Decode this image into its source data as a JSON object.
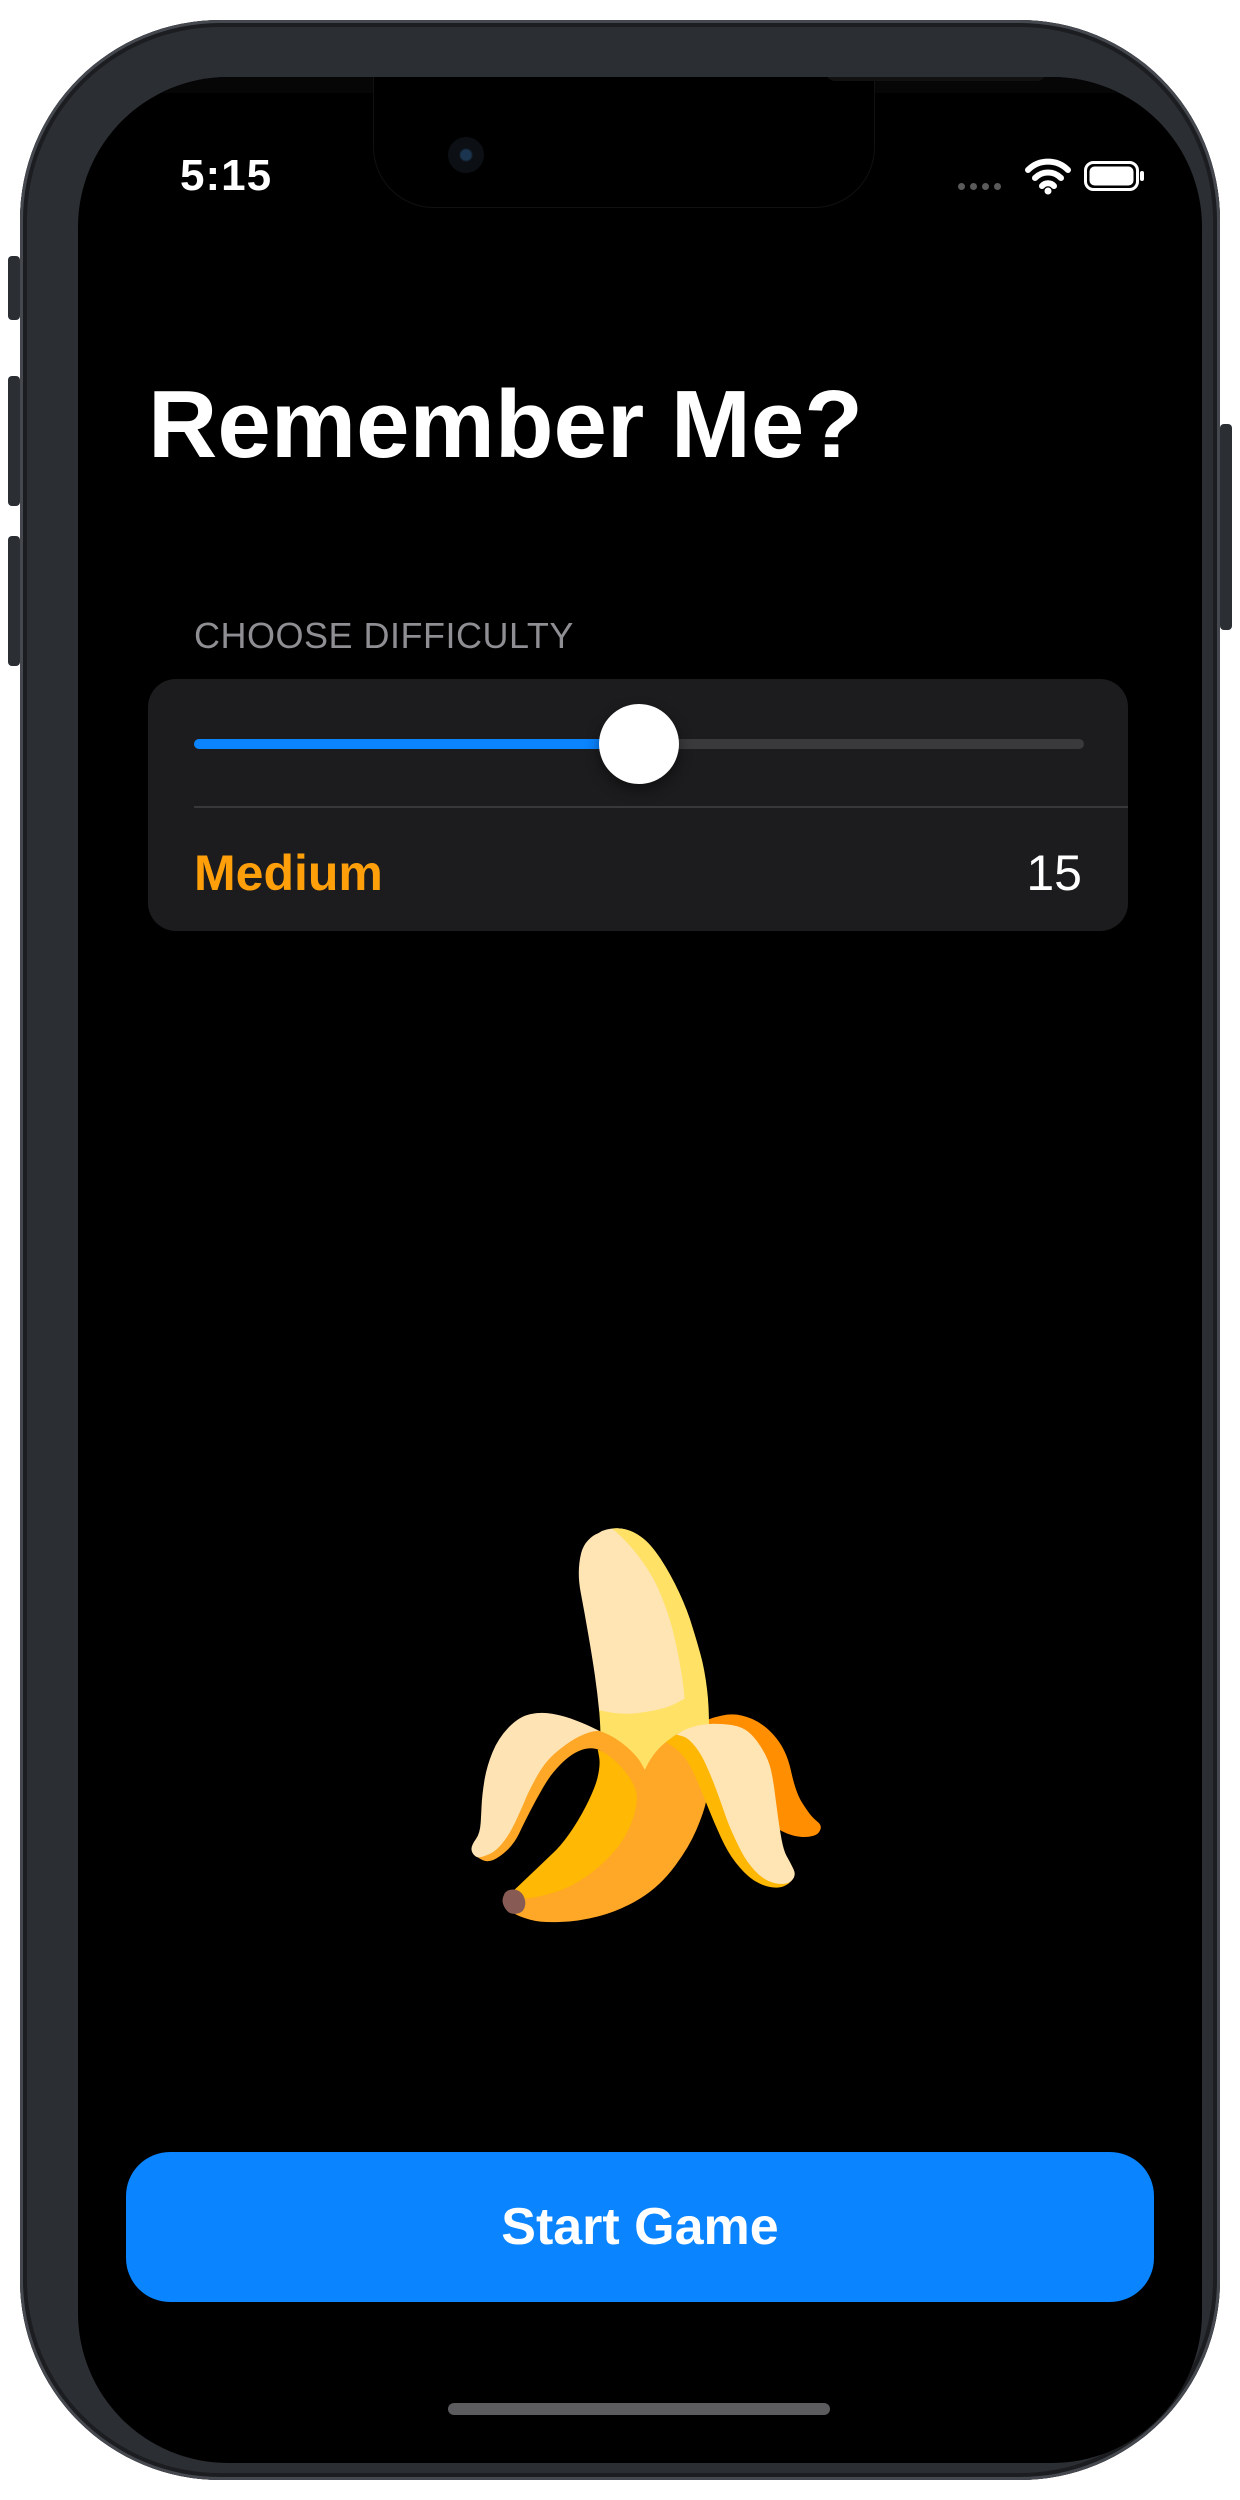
{
  "status_bar": {
    "time": "5:15",
    "icons": [
      "signal-dots-icon",
      "wifi-icon",
      "battery-icon"
    ]
  },
  "header": {
    "title": "Remember Me?"
  },
  "difficulty": {
    "section_label": "CHOOSE DIFFICULTY",
    "slider_fraction": 0.5,
    "level_name": "Medium",
    "value": "15"
  },
  "preview": {
    "emoji": "🍌"
  },
  "actions": {
    "start_label": "Start Game"
  },
  "colors": {
    "accent_blue": "#0a84ff",
    "difficulty_orange": "#ff9f0a",
    "card_background": "#1c1c1e",
    "screen_background": "#000000"
  }
}
